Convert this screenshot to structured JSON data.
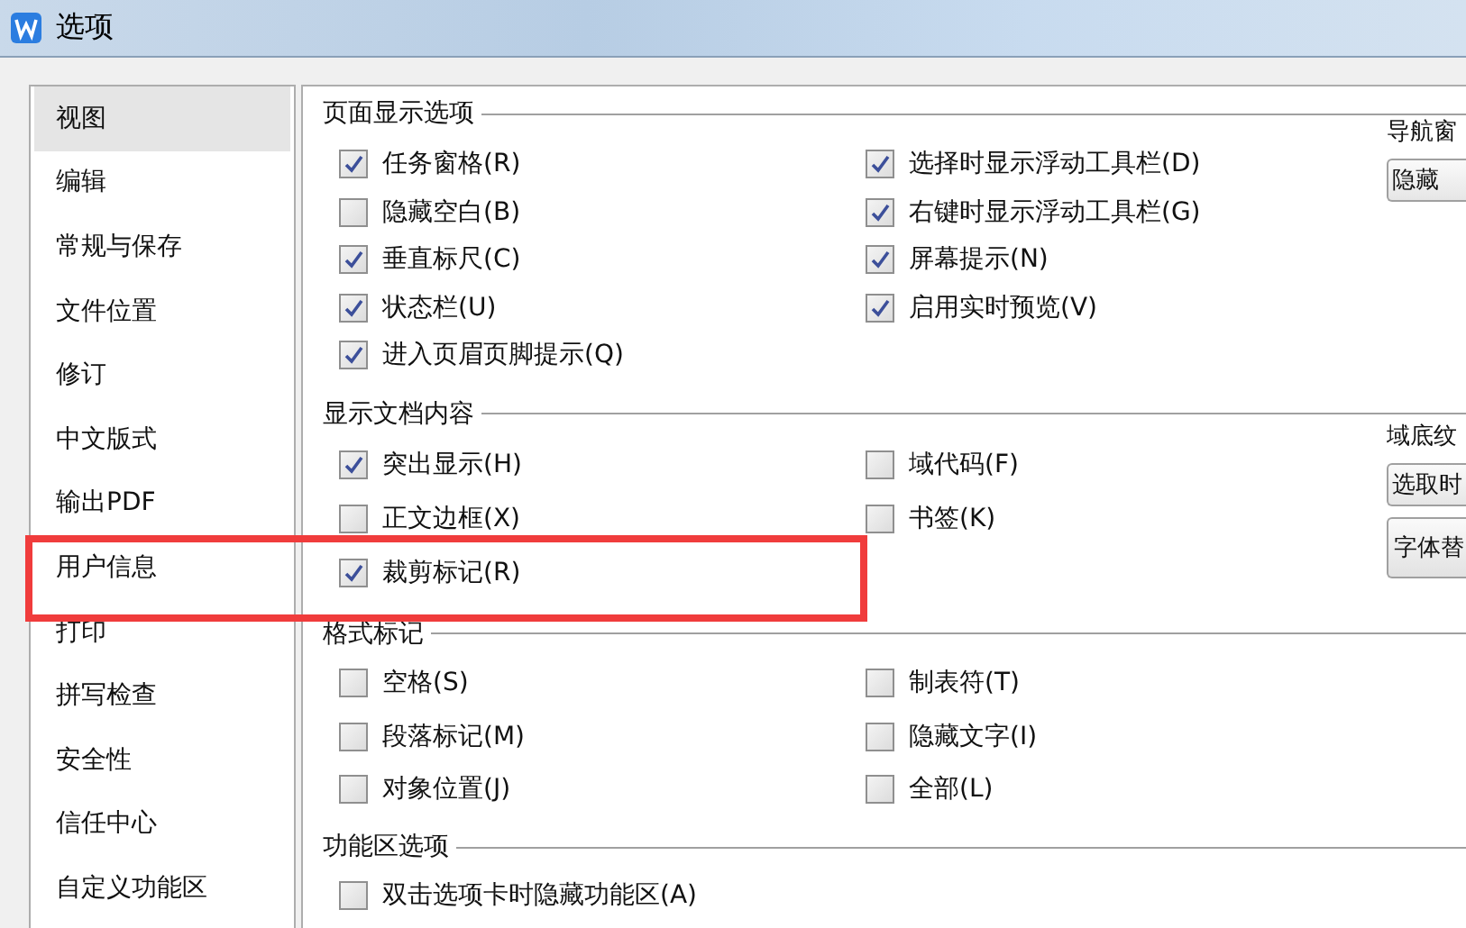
{
  "window": {
    "title": "选项"
  },
  "sidebar": {
    "items": [
      {
        "label": "视图",
        "selected": true
      },
      {
        "label": "编辑",
        "selected": false
      },
      {
        "label": "常规与保存",
        "selected": false
      },
      {
        "label": "文件位置",
        "selected": false
      },
      {
        "label": "修订",
        "selected": false
      },
      {
        "label": "中文版式",
        "selected": false
      },
      {
        "label": "输出PDF",
        "selected": false
      },
      {
        "label": "用户信息",
        "selected": false
      },
      {
        "label": "打印",
        "selected": false
      },
      {
        "label": "拼写检查",
        "selected": false
      },
      {
        "label": "安全性",
        "selected": false
      },
      {
        "label": "信任中心",
        "selected": false
      },
      {
        "label": "自定义功能区",
        "selected": false
      }
    ]
  },
  "sections": [
    {
      "title": "页面显示选项",
      "columns": [
        [
          {
            "label": "任务窗格(R)",
            "checked": true
          },
          {
            "label": "隐藏空白(B)",
            "checked": false
          },
          {
            "label": "垂直标尺(C)",
            "checked": true
          },
          {
            "label": "状态栏(U)",
            "checked": true
          },
          {
            "label": "进入页眉页脚提示(Q)",
            "checked": true
          }
        ],
        [
          {
            "label": "选择时显示浮动工具栏(D)",
            "checked": true
          },
          {
            "label": "右键时显示浮动工具栏(G)",
            "checked": true
          },
          {
            "label": "屏幕提示(N)",
            "checked": true
          },
          {
            "label": "启用实时预览(V)",
            "checked": true
          }
        ]
      ],
      "side": [
        {
          "kind": "label",
          "text": "导航窗"
        },
        {
          "kind": "dropdown",
          "text": "隐藏"
        }
      ]
    },
    {
      "title": "显示文档内容",
      "columns": [
        [
          {
            "label": "突出显示(H)",
            "checked": true
          },
          {
            "label": "正文边框(X)",
            "checked": false
          },
          {
            "label": "裁剪标记(R)",
            "checked": true
          }
        ],
        [
          {
            "label": "域代码(F)",
            "checked": false
          },
          {
            "label": "书签(K)",
            "checked": false
          }
        ]
      ],
      "side": [
        {
          "kind": "label",
          "text": "域底纹"
        },
        {
          "kind": "dropdown",
          "text": "选取时"
        },
        {
          "kind": "button",
          "text": "字体替"
        }
      ]
    },
    {
      "title": "格式标记",
      "columns": [
        [
          {
            "label": "空格(S)",
            "checked": false
          },
          {
            "label": "段落标记(M)",
            "checked": false
          },
          {
            "label": "对象位置(J)",
            "checked": false
          }
        ],
        [
          {
            "label": "制表符(T)",
            "checked": false
          },
          {
            "label": "隐藏文字(I)",
            "checked": false
          },
          {
            "label": "全部(L)",
            "checked": false
          }
        ]
      ]
    },
    {
      "title": "功能区选项",
      "columns": [
        [
          {
            "label": "双击选项卡时隐藏功能区(A)",
            "checked": false
          }
        ]
      ]
    }
  ],
  "annotation": {
    "kind": "highlight-box"
  }
}
